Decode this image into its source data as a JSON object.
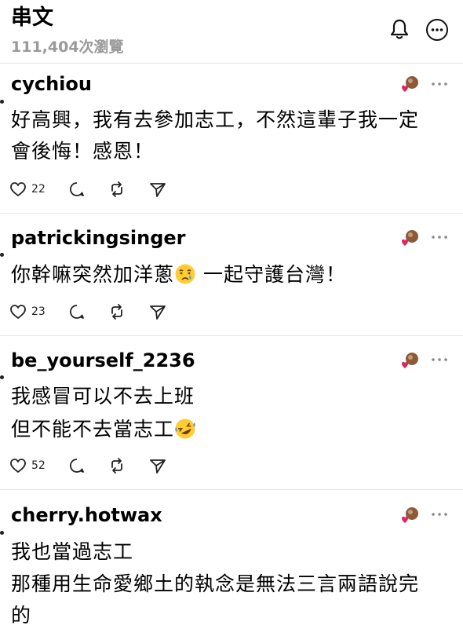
{
  "header": {
    "title": "串文",
    "views": "111,404次瀏覽",
    "bell_icon": "bell-icon",
    "more_icon": "more-circle-icon"
  },
  "posts": [
    {
      "username": "cychiou",
      "lines": [
        "好高興，我有去參加志工，不然這輩子我一定",
        "會後悔！感恩！"
      ],
      "likes": "22"
    },
    {
      "username": "patrickingsinger",
      "lines": [
        "你幹嘛突然加洋蔥",
        " 一起守護台灣！"
      ],
      "emoji": "crying-face-emoji",
      "likes": "23"
    },
    {
      "username": "be_yourself_2236",
      "lines": [
        "我感冒可以不去上班",
        "但不能不去當志工"
      ],
      "emoji": "rolling-laughing-emoji",
      "likes": "52"
    },
    {
      "username": "cherry.hotwax",
      "lines": [
        "我也當過志工",
        "那種用生命愛鄉土的執念是無法三言兩語說完",
        "的"
      ]
    }
  ],
  "icons": {
    "like": "heart-icon",
    "comment": "comment-icon",
    "repost": "repost-icon",
    "share": "send-icon",
    "author_avatar": "author-avatar",
    "post_menu": "ellipsis-icon"
  }
}
